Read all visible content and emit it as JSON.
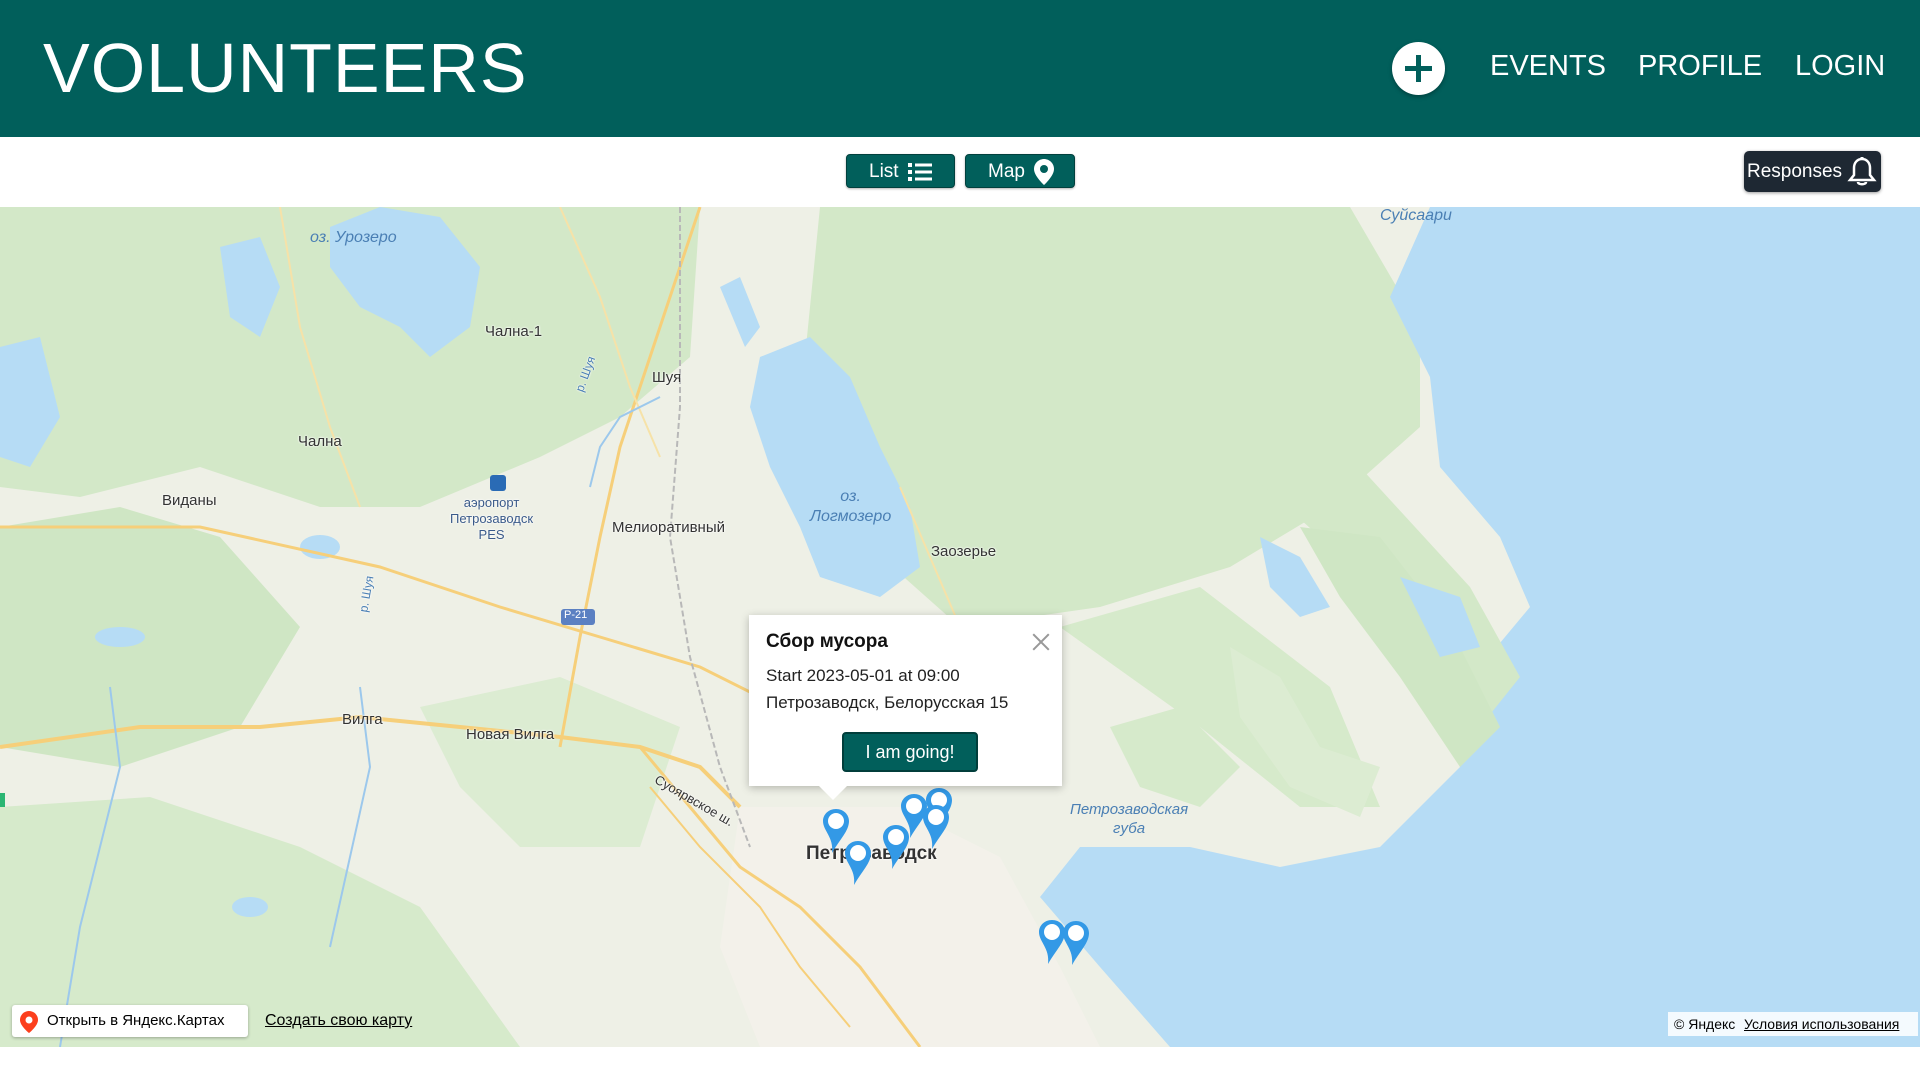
{
  "header": {
    "logo": "VOLUNTEERS",
    "nav": {
      "events": "EVENTS",
      "profile": "PROFILE",
      "login": "LOGIN"
    }
  },
  "toolbar": {
    "list_label": "List",
    "map_label": "Map",
    "responses_label": "Responses"
  },
  "map": {
    "labels": {
      "urozero": "оз. Урозеро",
      "suisaari": "Суйсаари",
      "chalna1": "Чална-1",
      "shuya": "Шуя",
      "r_shuya1": "р. Шуя",
      "chalna": "Чална",
      "vidany": "Виданы",
      "airport": "аэропорт\nПетрозаводск\nPES",
      "meliorativny": "Мелиоративный",
      "logmozero": "оз.\nЛогмозеро",
      "zaozerye": "Заозерье",
      "r21": "Р-21",
      "r_shuya2": "р. Шуя",
      "vilga": "Вилга",
      "novaya_vilga": "Новая Вилга",
      "suoyarvskoe": "Суоярвское ш.",
      "petrozavodsk": "Петрозаводск",
      "guba": "Петрозаводская\nгуба"
    },
    "open_in_yandex": "Открыть в Яндекс.Картах",
    "create_map": "Создать свою карту",
    "copyright": "© Яндекс",
    "terms": "Условия использования",
    "colors": {
      "water": "#b6dcf5",
      "land": "#eef0e6",
      "forest": "#cfe6c4",
      "pin": "#3399e6",
      "accent": "#015f5b"
    }
  },
  "popup": {
    "title": "Сбор мусора",
    "start": "Start 2023-05-01 at 09:00",
    "address": "Петрозаводск, Белорусская 15",
    "button": "I am going!"
  }
}
